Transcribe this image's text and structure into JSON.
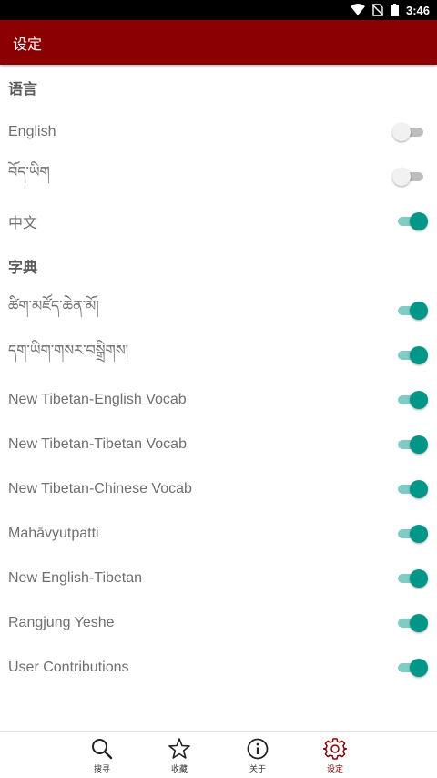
{
  "status_bar": {
    "time": "3:46"
  },
  "app_bar": {
    "title": "设定"
  },
  "sections": [
    {
      "header": "语言",
      "rows": [
        {
          "label": "English",
          "enabled": false
        },
        {
          "label": "བོད་ཡིག",
          "enabled": false
        },
        {
          "label": "中文",
          "enabled": true
        }
      ]
    },
    {
      "header": "字典",
      "rows": [
        {
          "label": "ཚིག་མཛོད་ཆེན་མོ།",
          "enabled": true
        },
        {
          "label": "དག་ཡིག་གསར་བསྒྲིགས།",
          "enabled": true
        },
        {
          "label": "New Tibetan-English Vocab",
          "enabled": true
        },
        {
          "label": "New Tibetan-Tibetan Vocab",
          "enabled": true
        },
        {
          "label": "New Tibetan-Chinese Vocab",
          "enabled": true
        },
        {
          "label": "Mahāvyutpatti",
          "enabled": true
        },
        {
          "label": "New English-Tibetan",
          "enabled": true
        },
        {
          "label": "Rangjung Yeshe",
          "enabled": true
        },
        {
          "label": "User Contributions",
          "enabled": true
        }
      ]
    }
  ],
  "bottom_nav": [
    {
      "label": "搜寻",
      "icon": "search-icon",
      "active": false
    },
    {
      "label": "收藏",
      "icon": "star-icon",
      "active": false
    },
    {
      "label": "关于",
      "icon": "info-icon",
      "active": false
    },
    {
      "label": "设定",
      "icon": "gear-icon",
      "active": true
    }
  ],
  "colors": {
    "app_bar": "#8b0000",
    "switch_on": "#009688",
    "switch_on_track": "#80cbc4",
    "switch_off_track": "#bdbdbd",
    "active_nav": "#8b0000"
  }
}
